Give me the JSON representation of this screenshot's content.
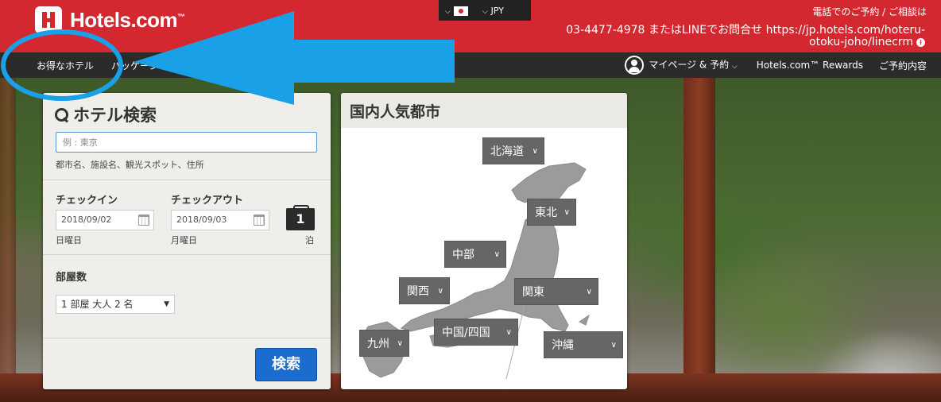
{
  "header": {
    "brand": "Hotels.com",
    "brand_tm": "™",
    "locale": {
      "currency": "JPY"
    },
    "contact_label": "電話でのご予約 / ご相談は",
    "contact_line": "03-4477-4978 またはLINEでお問合せ https://jp.hotels.com/hoteru-otoku-joho/linecrm"
  },
  "nav": {
    "left": [
      "お得なホテル",
      "パッケージ"
    ],
    "right": {
      "mypage": "マイページ & 予約",
      "rewards": "Hotels.com™ Rewards",
      "booking": "ご予約内容"
    }
  },
  "search": {
    "title": "ホテル検索",
    "destination_placeholder": "例 : 東京",
    "destination_hint": "都市名、施設名、観光スポット、住所",
    "checkin_label": "チェックイン",
    "checkout_label": "チェックアウト",
    "checkin_date": "2018/09/02",
    "checkout_date": "2018/09/03",
    "checkin_day": "日曜日",
    "checkout_day": "月曜日",
    "nights": "1",
    "nights_unit": "泊",
    "rooms_label": "部屋数",
    "rooms_value": "1 部屋 大人 2 名",
    "submit": "検索"
  },
  "popular": {
    "title": "国内人気都市",
    "regions": {
      "hokkaido": "北海道",
      "tohoku": "東北",
      "chubu": "中部",
      "kansai": "関西",
      "kanto": "関東",
      "chugoku_shikoku": "中国/四国",
      "kyushu": "九州",
      "okinawa": "沖縄"
    }
  },
  "colors": {
    "brand_red": "#d3282f",
    "nav_dark": "#2b2b2b",
    "search_blue": "#1a6ccf",
    "annotation_blue": "#1aa0e6",
    "region_gray": "#666666"
  }
}
